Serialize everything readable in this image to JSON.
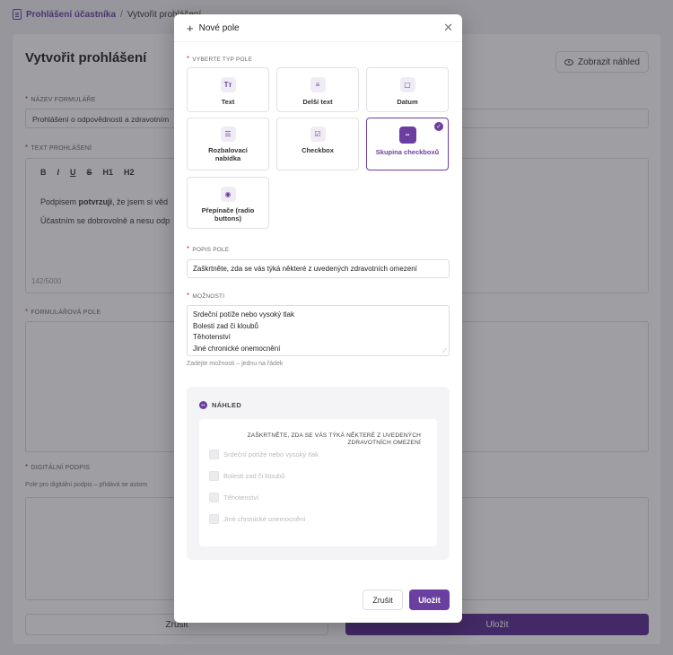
{
  "breadcrumb": {
    "parent": "Prohlášení účastníka",
    "separator": "/",
    "current": "Vytvořit prohlášení"
  },
  "background": {
    "title": "Vytvořit prohlášení",
    "preview_button": "Zobrazit náhled",
    "form_name_label": "Název formuláře",
    "form_name_value": "Prohlášení o odpovědnosti a zdravotním",
    "declaration_label": "Text prohlášení",
    "toolbar": [
      "B",
      "I",
      "U",
      "S",
      "H1",
      "H2"
    ],
    "editor_line1_pre": "Podpisem ",
    "editor_line1_bold": "potvrzuji",
    "editor_line1_post": ", že jsem si věd",
    "editor_line2": "Účastním se dobrovolně a nesu odp",
    "char_count": "142/5000",
    "fields_label": "Formulářová pole",
    "signature_label": "Digitální podpis",
    "signature_sub": "Pole pro digitální podpis – přidává se autom",
    "cancel": "Zrušit",
    "save": "Uložit"
  },
  "modal": {
    "title": "Nové pole",
    "type_label": "Vyberte typ pole",
    "types": [
      {
        "label": "Text",
        "icon": "Tт"
      },
      {
        "label": "Delší text",
        "icon": "≡"
      },
      {
        "label": "Datum",
        "icon": "▢"
      },
      {
        "label": "Rozbalovací nabídka",
        "icon": "☰"
      },
      {
        "label": "Checkbox",
        "icon": "☑"
      },
      {
        "label": "Skupina checkboxů",
        "icon": "▪▪"
      },
      {
        "label": "Přepínače (radio buttons)",
        "icon": "◉"
      }
    ],
    "selected_type": "Skupina checkboxů",
    "description_label": "Popis pole",
    "description_value": "Zaškrtněte, zda se vás týká některé z uvedených zdravotních omezení",
    "options_label": "Možnosti",
    "options": [
      "Srdeční potíže nebo vysoký tlak",
      "Bolesti zad či kloubů",
      "Těhotenství",
      "Jiné chronické onemocnění"
    ],
    "options_hint": "Zadejte možnosti – jednu na řádek",
    "preview_label": "NÁHLED",
    "preview_question": "Zaškrtněte, zda se vás týká některé z uvedených zdravotních omezení",
    "cancel": "Zrušit",
    "save": "Uložit"
  },
  "colors": {
    "accent": "#6b3fa0",
    "dark_accent": "#5a2d91",
    "required": "#c0392b"
  }
}
